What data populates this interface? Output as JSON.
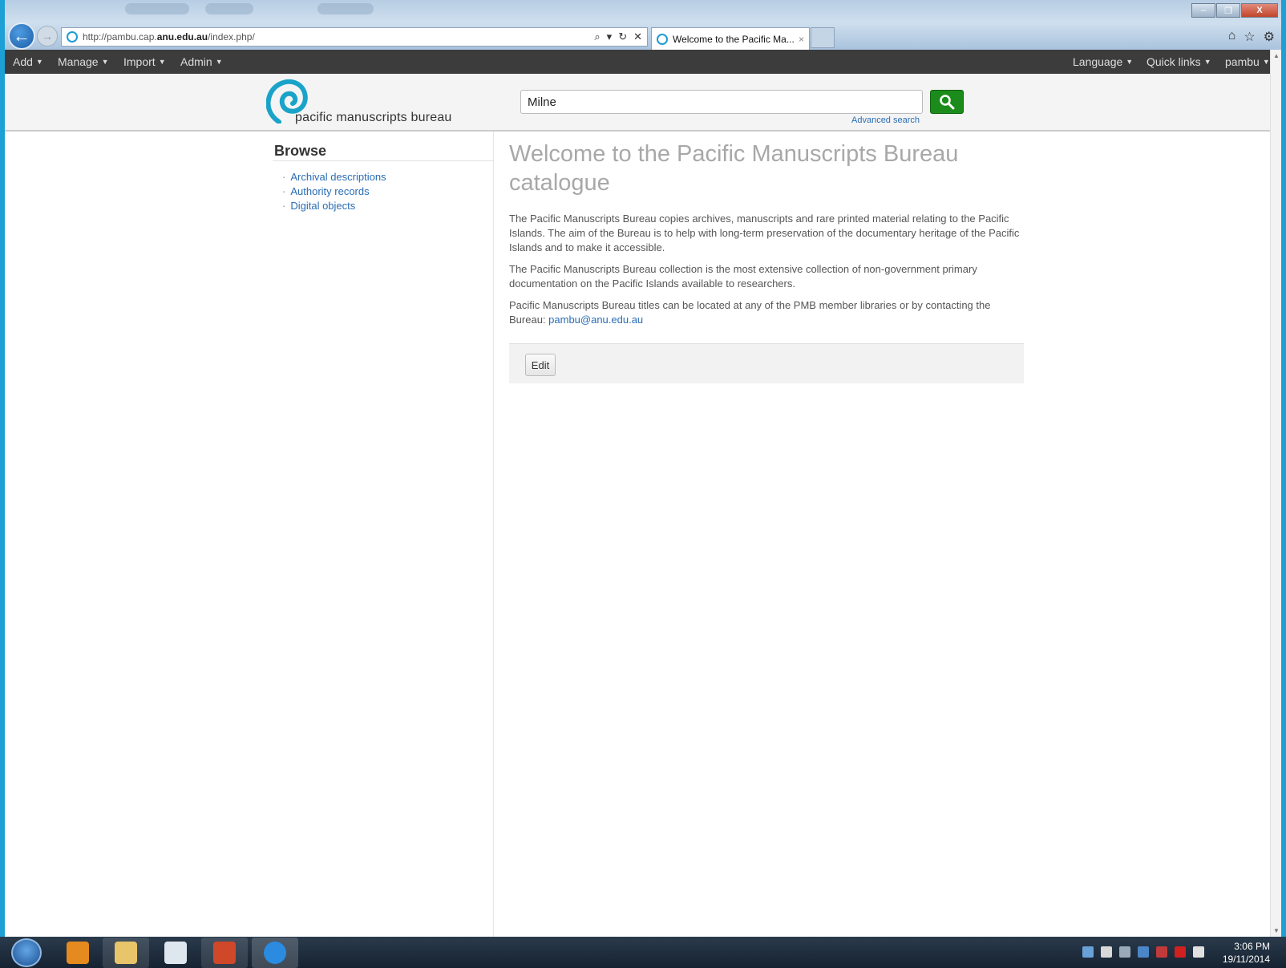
{
  "browser": {
    "url_prefix": "http://pambu.cap.",
    "url_domain": "anu.edu.au",
    "url_suffix": "/index.php/",
    "tab_title": "Welcome to the Pacific Ma...",
    "window_controls": {
      "minimize": "–",
      "restore": "❐",
      "close": "X"
    }
  },
  "topbar": {
    "left_menus": [
      "Add",
      "Manage",
      "Import",
      "Admin"
    ],
    "right_menus": [
      "Language",
      "Quick links",
      "pambu"
    ]
  },
  "header": {
    "logo_text": "pacific manuscripts bureau",
    "search_value": "Milne",
    "advanced_search_label": "Advanced search"
  },
  "sidebar": {
    "title": "Browse",
    "items": [
      "Archival descriptions",
      "Authority records",
      "Digital objects"
    ]
  },
  "main": {
    "title": "Welcome to the Pacific Manuscripts Bureau catalogue",
    "paragraphs": [
      "The Pacific Manuscripts Bureau copies archives, manuscripts and rare printed material relating to the Pacific Islands. The aim of the Bureau is to help with long-term preservation of the documentary heritage of the Pacific Islands and to make it accessible.",
      "The Pacific Manuscripts Bureau collection is the most extensive collection of non-government primary documentation on the Pacific Islands available to researchers."
    ],
    "contact_text": "Pacific Manuscripts Bureau titles can be located at any of the PMB member libraries or by contacting the Bureau: ",
    "contact_email": "pambu@anu.edu.au",
    "edit_label": "Edit"
  },
  "taskbar": {
    "apps": [
      "outlook-icon",
      "file-explorer-icon",
      "window-app-icon",
      "powerpoint-icon",
      "internet-explorer-icon"
    ],
    "time": "3:06 PM",
    "date": "19/11/2014"
  },
  "colors": {
    "topbar_bg": "#3c3c3c",
    "search_button": "#1b8c1b",
    "link": "#2a6db5",
    "logo_teal": "#1aa3c8"
  }
}
